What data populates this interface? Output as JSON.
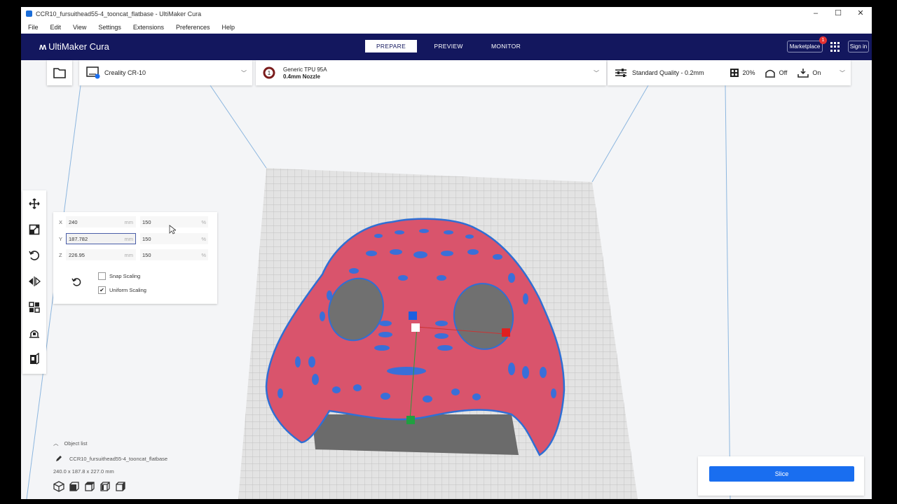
{
  "window": {
    "title": "CCR10_fursuithead55-4_tooncat_flatbase - UltiMaker Cura",
    "controls": [
      "–",
      "☐",
      "✕"
    ]
  },
  "menu": [
    "File",
    "Edit",
    "View",
    "Settings",
    "Extensions",
    "Preferences",
    "Help"
  ],
  "header": {
    "logo": "UltiMaker Cura",
    "tabs": [
      "PREPARE",
      "PREVIEW",
      "MONITOR"
    ],
    "marketplace": "Marketplace",
    "badge": "1",
    "signin": "Sign in"
  },
  "printer": {
    "name": "Creality CR-10"
  },
  "material": {
    "name": "Generic TPU 95A",
    "nozzle": "0.4mm Nozzle"
  },
  "print_settings": {
    "profile": "Standard Quality - 0.2mm",
    "infill": "20%",
    "support": "Off",
    "adhesion": "On"
  },
  "scale": {
    "rows": [
      {
        "axis": "X",
        "mm": "240",
        "pct": "150"
      },
      {
        "axis": "Y",
        "mm": "187.782",
        "pct": "150"
      },
      {
        "axis": "Z",
        "mm": "226.95",
        "pct": "150"
      }
    ],
    "unit_mm": "mm",
    "unit_pct": "%",
    "snap": "Snap Scaling",
    "uniform": "Uniform Scaling"
  },
  "object_list": {
    "label": "Object list",
    "file": "CCR10_fursuithead55-4_tooncat_flatbase",
    "dims": "240.0 x 187.8 x 227.0 mm"
  },
  "slice": {
    "label": "Slice"
  },
  "colors": {
    "header": "#13175e",
    "accent": "#196ef0",
    "model": "#d9546c",
    "outline": "#2f6fd4"
  }
}
